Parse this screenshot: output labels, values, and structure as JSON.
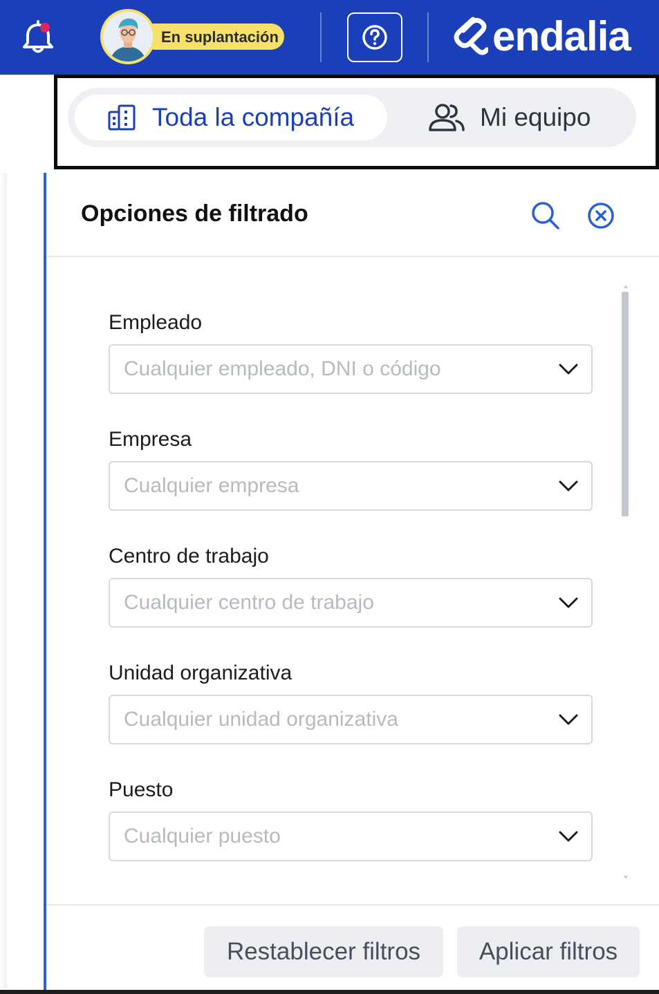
{
  "header": {
    "impersonation_label": "En suplantación",
    "logo_text": "endalia",
    "bell_badge_color": "#e0245e",
    "brand_color": "#1a3fb8"
  },
  "scope_toggle": {
    "active_tab": "Toda la compañía",
    "other_tab": "Mi equipo"
  },
  "filter_panel": {
    "title": "Opciones de filtrado",
    "fields": [
      {
        "label": "Empleado",
        "placeholder": "Cualquier empleado, DNI o código"
      },
      {
        "label": "Empresa",
        "placeholder": "Cualquier empresa"
      },
      {
        "label": "Centro de trabajo",
        "placeholder": "Cualquier centro de trabajo"
      },
      {
        "label": "Unidad organizativa",
        "placeholder": "Cualquier unidad organizativa"
      },
      {
        "label": "Puesto",
        "placeholder": "Cualquier puesto"
      }
    ],
    "reset_label": "Restablecer filtros",
    "apply_label": "Aplicar filtros"
  }
}
